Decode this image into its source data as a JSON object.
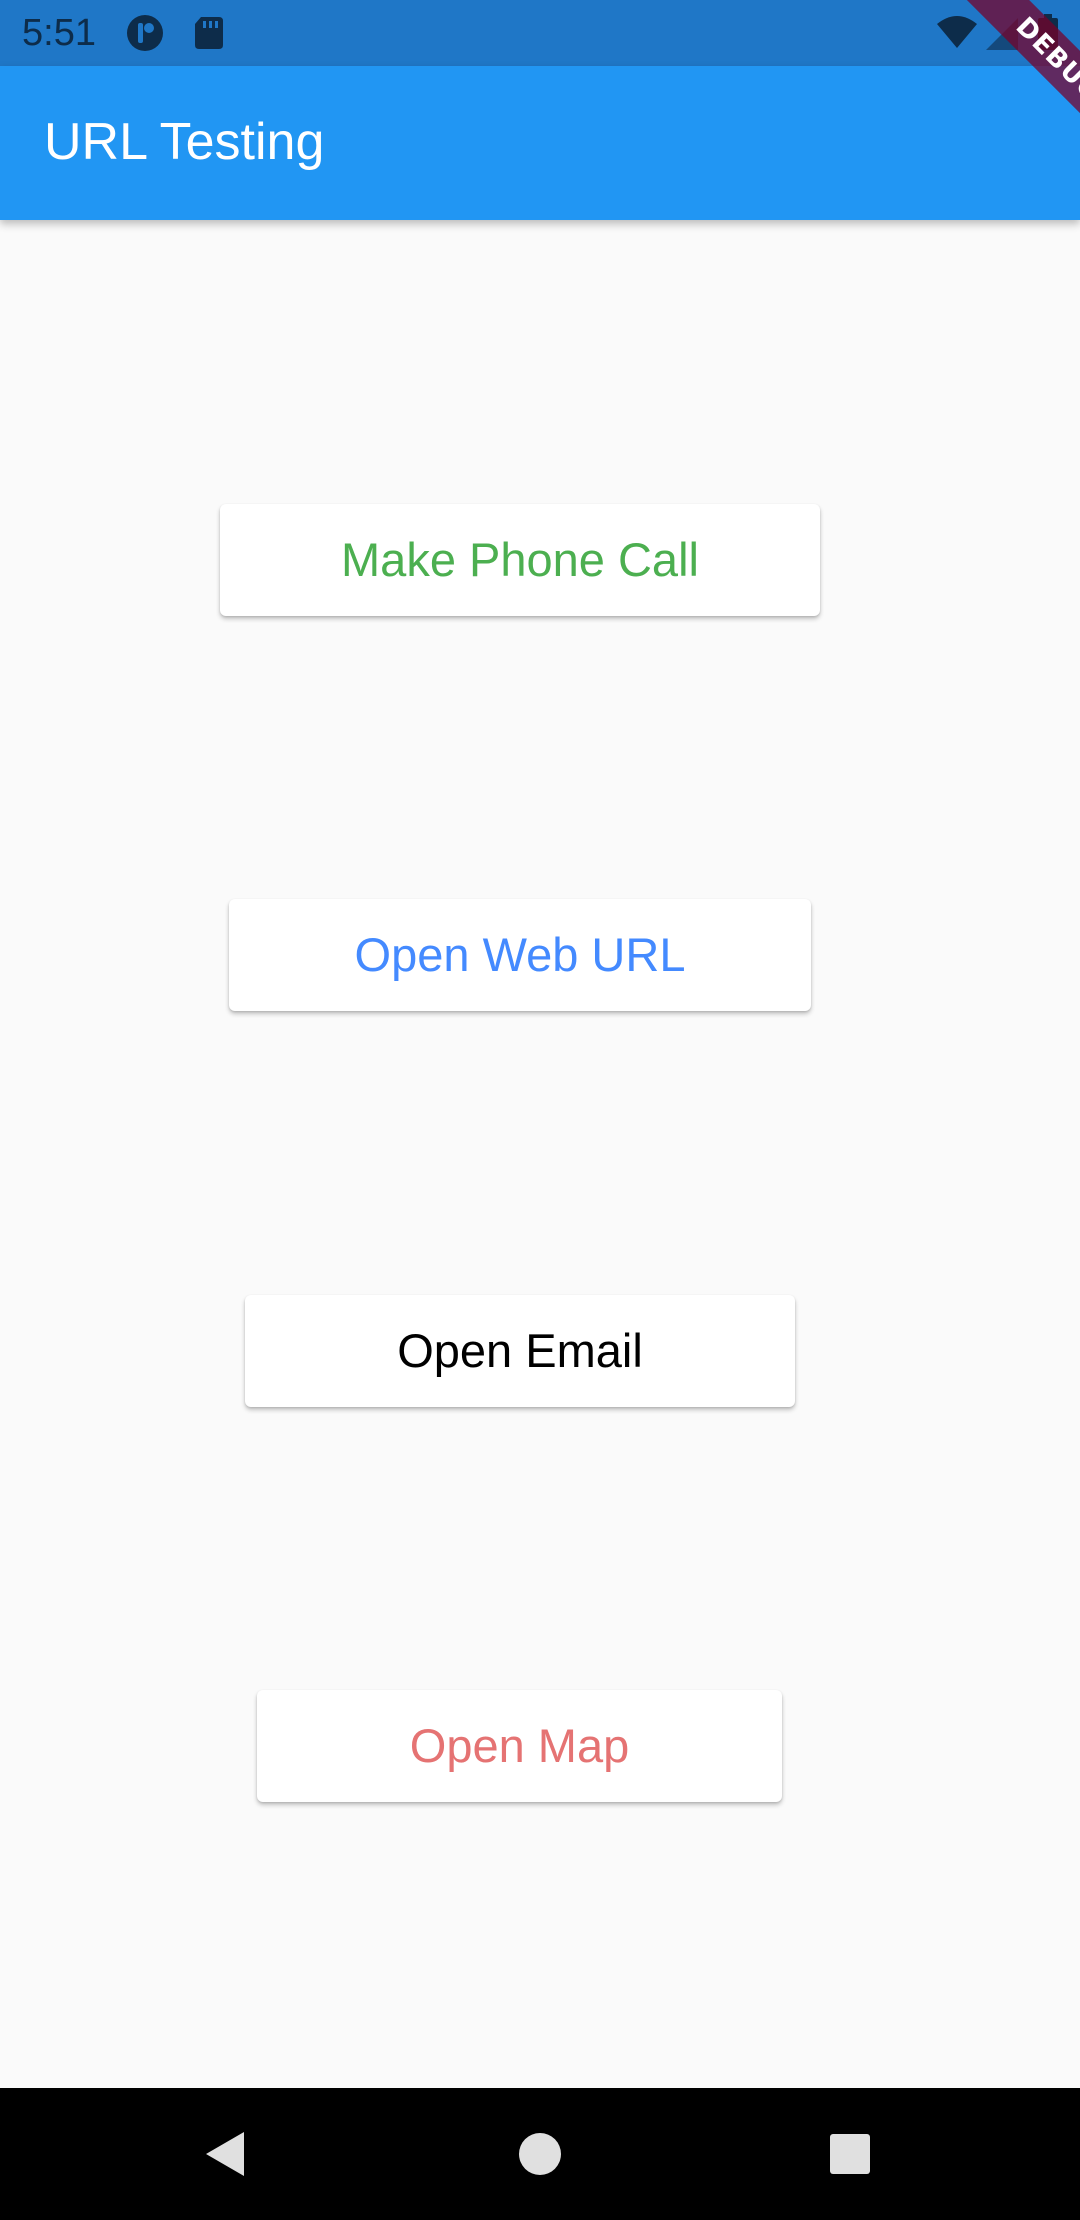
{
  "status_bar": {
    "time": "5:51",
    "icons_left": [
      "app-notification-icon",
      "sd-card-icon"
    ],
    "icons_right": [
      "wifi-icon",
      "signal-icon",
      "battery-icon"
    ]
  },
  "app_bar": {
    "title": "URL Testing",
    "color": "#2196f3"
  },
  "debug_banner": {
    "label": "DEBUG"
  },
  "buttons": [
    {
      "label": "Make Phone Call",
      "color": "#4caf50"
    },
    {
      "label": "Open Web URL",
      "color": "#448aff"
    },
    {
      "label": "Open Email",
      "color": "#000000"
    },
    {
      "label": "Open Map",
      "color": "#e57373"
    }
  ],
  "nav_bar": {
    "icons": [
      "back-icon",
      "home-icon",
      "recents-icon"
    ]
  }
}
